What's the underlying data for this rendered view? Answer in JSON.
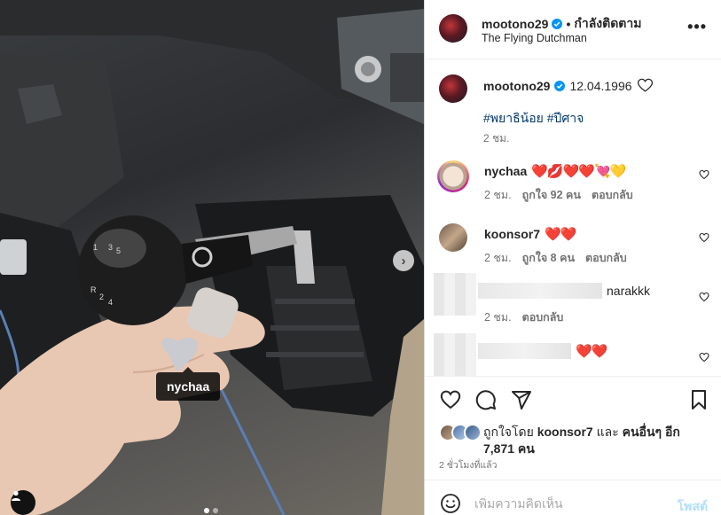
{
  "media": {
    "tag_label": "nychaa",
    "next_icon": "chevron-right-icon",
    "shift_pattern": [
      "1",
      "3",
      "5",
      "2",
      "4",
      "R"
    ]
  },
  "header": {
    "username": "mootono29",
    "separator": "•",
    "follow_label": "กำลังติดตาม",
    "subtitle": "The Flying Dutchman",
    "more_label": "•••"
  },
  "caption": {
    "username": "mootono29",
    "text": "12.04.1996",
    "hashtags": "#พยาธิน้อย #ปีศาจ",
    "time": "2 ชม."
  },
  "comments": [
    {
      "username": "nychaa",
      "text": "❤️💋❤️❤️💘💛",
      "time": "2 ชม.",
      "likes": "ถูกใจ 92 คน",
      "reply": "ตอบกลับ"
    },
    {
      "username": "koonsor7",
      "text": "❤️❤️",
      "time": "2 ชม.",
      "likes": "ถูกใจ 8 คน",
      "reply": "ตอบกลับ"
    },
    {
      "username": "",
      "text": "narakkk",
      "time": "2 ชม.",
      "likes": "",
      "reply": "ตอบกลับ"
    },
    {
      "username": "",
      "text": "❤️❤️",
      "time": "",
      "likes": "",
      "reply": ""
    }
  ],
  "likes": {
    "prefix": "ถูกใจโดย",
    "user": "koonsor7",
    "middle": "และ",
    "others": "คนอื่นๆ อีก 7,871 คน"
  },
  "posted": "2 ชั่วโมงที่แล้ว",
  "add_comment": {
    "placeholder": "เพิ่มความคิดเห็น",
    "post_label": "โพสต์"
  },
  "colors": {
    "verified": "#0095f6",
    "link": "#00376b",
    "muted": "#737373",
    "post_disabled": "#b2dffc"
  }
}
